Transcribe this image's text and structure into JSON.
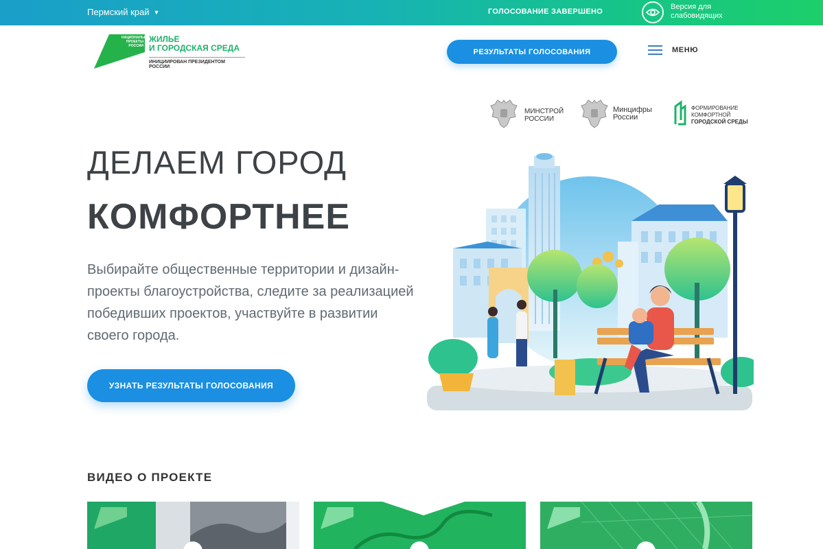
{
  "topbar": {
    "region": "Пермский край",
    "vote_status": "ГОЛОСОВАНИЕ ЗАВЕРШЕНО",
    "vision_version": "Версия для слабовидящих"
  },
  "header": {
    "logo": {
      "mark_text": "НАЦИОНАЛЬНЫЕ ПРОЕКТЫ РОССИИ",
      "title_line1": "ЖИЛЬЕ",
      "title_line2": "И ГОРОДСКАЯ СРЕДА",
      "subtitle": "ИНИЦИИРОВАН ПРЕЗИДЕНТОМ РОССИИ"
    },
    "results_button": "РЕЗУЛЬТАТЫ ГОЛОСОВАНИЯ",
    "menu_label": "МЕНЮ"
  },
  "partners": [
    {
      "name": "МИНСТРОЙ РОССИИ",
      "line1": "МИНСТРОЙ",
      "line2": "РОССИИ"
    },
    {
      "name": "Минцифры России",
      "line1": "Минцифры",
      "line2": "России"
    },
    {
      "name": "ФОРМИРОВАНИЕ КОМФОРТНОЙ ГОРОДСКОЙ СРЕДЫ",
      "line1": "ФОРМИРОВАНИЕ",
      "line2": "КОМФОРТНОЙ",
      "line3": "ГОРОДСКОЙ СРЕДЫ"
    }
  ],
  "hero": {
    "title_line1": "ДЕЛАЕМ ГОРОД",
    "title_line2": "КОМФОРТНЕЕ",
    "description": "Выбирайте общественные территории и дизайн-проекты благоустройства, следите за реализацией победивших проектов, участвуйте в развитии своего города.",
    "cta_button": "УЗНАТЬ РЕЗУЛЬТАТЫ ГОЛОСОВАНИЯ"
  },
  "video_section": {
    "title": "ВИДЕО О ПРОЕКТЕ"
  },
  "colors": {
    "accent_blue": "#1b8fe2",
    "brand_green": "#1fb26a",
    "topbar_gradient_start": "#1a9fc9",
    "topbar_gradient_end": "#1dcf6a",
    "text_dark": "#3d4246"
  }
}
